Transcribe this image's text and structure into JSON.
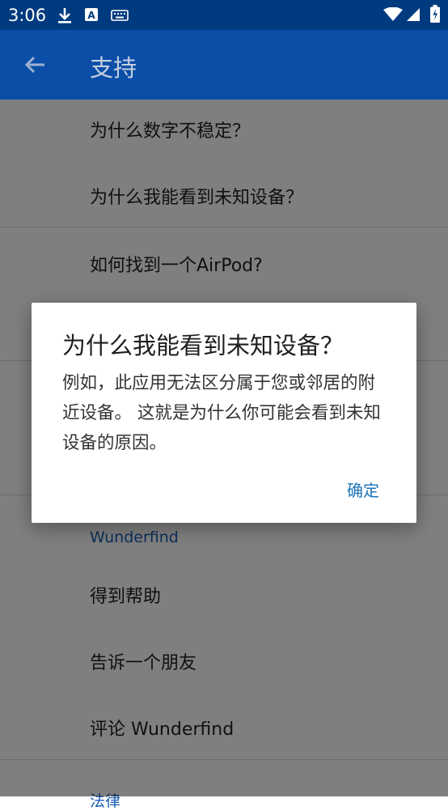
{
  "status_bar": {
    "time": "3:06",
    "icons": [
      "download-icon",
      "a-badge-icon",
      "keyboard-icon",
      "wifi-icon",
      "signal-icon",
      "battery-icon"
    ]
  },
  "app_bar": {
    "title": "支持",
    "back_icon": "arrow-back-icon",
    "background": "#0a4ea8"
  },
  "list": {
    "faq_items": [
      "为什么数字不稳定？",
      "为什么我能看到未知设备？",
      "如何找到一个AirPod?"
    ],
    "section_wunderfind": "Wunderfind",
    "wunderfind_items": [
      "得到帮助",
      "告诉一个朋友",
      "评论 Wunderfind"
    ],
    "section_legal_partial": "法律"
  },
  "dialog": {
    "title": "为什么我能看到未知设备？",
    "body": "例如，此应用无法区分属于您或邻居的附近设备。 这就是为什么你可能会看到未知设备的原因。",
    "confirm_button": "确定"
  },
  "colors": {
    "status_bar": "#003a7f",
    "accent_link": "#1a73b8",
    "section_header": "#1a5fb4"
  }
}
